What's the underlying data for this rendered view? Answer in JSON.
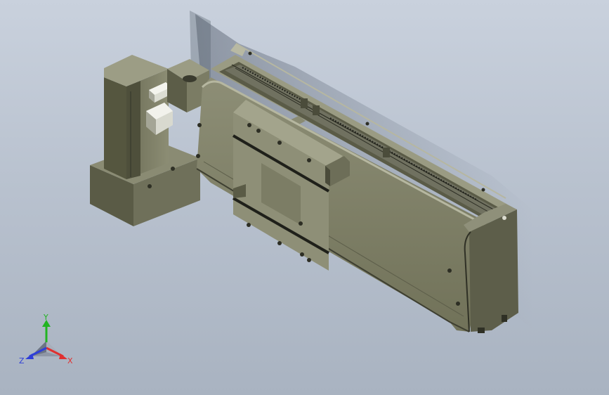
{
  "viewport": {
    "background_top": "#c9d1dd",
    "background_bottom": "#a9b3c1",
    "model_color": "#7a7b63",
    "model_dark": "#4d4e3e",
    "model_light": "#9a9b83"
  },
  "triad": {
    "x_label": "X",
    "y_label": "Y",
    "z_label": "Z",
    "x_color": "#e03030",
    "y_color": "#22b422",
    "z_color": "#2f3fd8"
  }
}
